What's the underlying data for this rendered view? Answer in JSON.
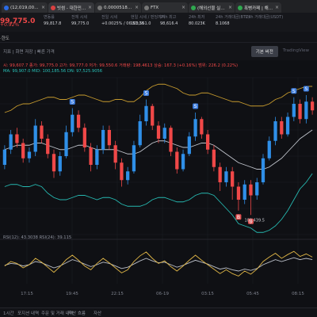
{
  "browser_tabs": [
    {
      "label": "(12,019,000 ↑) Coin…",
      "fav": "coin-logo-icon",
      "active": false
    },
    {
      "label": "빗썸 - 대한민국 대…",
      "fav": "bithumb-logo-icon",
      "active": true
    },
    {
      "label": "0.00005189 DAC…",
      "fav": "grey-logo-icon",
      "active": false
    },
    {
      "label": "FTX",
      "fav": "ftx-logo-icon",
      "active": false
    },
    {
      "label": "(해외선물 실전트…",
      "fav": "news-logo-icon",
      "active": false
    },
    {
      "label": "폭뻥카페 | 해선…",
      "fav": "cafe-logo-icon",
      "active": false
    }
  ],
  "ticker": {
    "price": "99,775.0",
    "change": "+0.92%",
    "stats": [
      {
        "key": "변동률",
        "value": "99,817.8"
      },
      {
        "key": "전체 시세",
        "value": "99,775.0"
      },
      {
        "key": "전일 시세",
        "value": "+0.0025% / 06:51:16"
      },
      {
        "key": "현일 시세 / 펀딩까지",
        "value": "103,551.0"
      },
      {
        "key": "24h 최고",
        "value": "98,616.4"
      },
      {
        "key": "24h 최저",
        "value": "80.023K"
      },
      {
        "key": "24h 거래대금(BTC)",
        "value": "8.1068"
      },
      {
        "key": "24h 거래대금(USDT)",
        "value": ""
      }
    ]
  },
  "toolbar": {
    "label": "·한도",
    "view_basic": "기본 버전",
    "view_tv": "TradingView",
    "indicator": "지표 | 화면 저장 | 빠른 가격"
  },
  "legend": {
    "ohlc": "시: 99,607.7  종가: 99,775.0  고가: 99,777.0  저가: 99,550.6  거래량: 198.4613  상승: 167.3 (+0.16%)  범위: 226.2 (0.22%)",
    "bb": "MA: 99,907.0  MID: 100,185.56  DN: 97,525.9056",
    "rsi": "RSI(12): 43.3038  RSI(24): 39.115"
  },
  "chart_data": {
    "type": "candlestick",
    "low_label": "103,439.5",
    "time_labels": [
      "17:15",
      "19:45",
      "22:15",
      "06-19",
      "03:15",
      "05:45",
      "08:15"
    ],
    "candles": [
      [
        99.2,
        99.9,
        99.0,
        100.1
      ],
      [
        99.9,
        100.6,
        99.7,
        100.8
      ],
      [
        100.6,
        100.2,
        100.0,
        100.9
      ],
      [
        100.2,
        99.5,
        99.3,
        100.4
      ],
      [
        99.5,
        99.8,
        99.3,
        100.0
      ],
      [
        99.8,
        101.0,
        99.6,
        101.3
      ],
      [
        101.0,
        100.4,
        100.2,
        101.2
      ],
      [
        100.4,
        99.7,
        99.5,
        100.6
      ],
      [
        99.7,
        98.9,
        98.6,
        99.9
      ],
      [
        98.9,
        99.6,
        98.7,
        99.8
      ],
      [
        99.6,
        100.7,
        99.5,
        101.0
      ],
      [
        100.7,
        101.5,
        100.5,
        101.8
      ],
      [
        101.5,
        100.9,
        100.7,
        101.7
      ],
      [
        100.9,
        100.0,
        99.8,
        101.1
      ],
      [
        100.0,
        99.2,
        98.9,
        100.2
      ],
      [
        99.2,
        99.9,
        99.0,
        100.1
      ],
      [
        99.9,
        100.8,
        99.7,
        101.0
      ],
      [
        100.8,
        100.1,
        99.9,
        101.0
      ],
      [
        100.1,
        99.3,
        99.0,
        100.3
      ],
      [
        99.3,
        98.5,
        98.2,
        99.5
      ],
      [
        98.5,
        98.9,
        98.3,
        99.1
      ],
      [
        98.9,
        100.1,
        98.8,
        100.3
      ],
      [
        100.1,
        101.2,
        100.0,
        101.5
      ],
      [
        101.2,
        101.9,
        101.0,
        102.2
      ],
      [
        101.9,
        101.0,
        100.8,
        102.0
      ],
      [
        101.0,
        100.4,
        100.2,
        101.2
      ],
      [
        100.4,
        100.9,
        100.2,
        101.1
      ],
      [
        100.9,
        99.8,
        99.6,
        101.0
      ],
      [
        99.8,
        99.0,
        98.8,
        100.0
      ],
      [
        99.0,
        99.7,
        98.9,
        99.9
      ],
      [
        99.7,
        100.5,
        99.6,
        100.7
      ],
      [
        100.5,
        101.3,
        100.3,
        101.6
      ],
      [
        101.3,
        100.6,
        100.4,
        101.4
      ],
      [
        100.6,
        99.9,
        99.7,
        100.8
      ],
      [
        99.9,
        99.1,
        98.9,
        100.1
      ],
      [
        99.1,
        98.4,
        98.0,
        99.3
      ],
      [
        98.4,
        98.9,
        98.2,
        99.1
      ],
      [
        98.9,
        98.2,
        97.6,
        99.1
      ],
      [
        98.2,
        97.6,
        97.1,
        98.4
      ],
      [
        97.6,
        98.3,
        97.4,
        98.5
      ],
      [
        98.3,
        97.8,
        96.9,
        98.5
      ],
      [
        97.8,
        98.4,
        97.6,
        98.6
      ],
      [
        98.4,
        99.5,
        98.3,
        99.7
      ],
      [
        99.5,
        100.3,
        99.4,
        100.5
      ],
      [
        100.3,
        101.2,
        100.1,
        101.4
      ],
      [
        101.2,
        100.6,
        100.4,
        101.4
      ],
      [
        100.6,
        101.4,
        100.5,
        101.6
      ],
      [
        101.4,
        102.0,
        101.2,
        102.3
      ],
      [
        102.0,
        101.3,
        101.1,
        102.2
      ],
      [
        101.3,
        102.1,
        101.1,
        102.4
      ],
      [
        102.1,
        101.7,
        101.5,
        102.3
      ]
    ],
    "bb_upper": [
      101.6,
      101.7,
      101.9,
      102.0,
      102.0,
      102.1,
      102.2,
      102.3,
      102.3,
      102.2,
      102.2,
      102.3,
      102.4,
      102.4,
      102.3,
      102.2,
      102.1,
      102.1,
      102.2,
      102.2,
      102.1,
      102.1,
      102.3,
      102.6,
      102.8,
      102.9,
      102.9,
      102.8,
      102.7,
      102.5,
      102.4,
      102.4,
      102.5,
      102.5,
      102.4,
      102.3,
      102.2,
      102.1,
      102.1,
      102.0,
      101.9,
      101.9,
      101.9,
      102.0,
      102.2,
      102.3,
      102.5,
      102.6,
      102.7,
      102.8,
      102.8
    ],
    "bb_mid": [
      99.9,
      100.0,
      100.1,
      100.1,
      100.1,
      100.2,
      100.2,
      100.1,
      100.0,
      99.9,
      99.9,
      100.0,
      100.1,
      100.1,
      100.0,
      99.9,
      99.9,
      99.9,
      99.9,
      99.8,
      99.7,
      99.7,
      99.8,
      100.0,
      100.2,
      100.3,
      100.3,
      100.2,
      100.1,
      100.0,
      100.0,
      100.1,
      100.2,
      100.2,
      100.1,
      99.9,
      99.7,
      99.5,
      99.3,
      99.2,
      99.1,
      99.0,
      99.0,
      99.1,
      99.3,
      99.5,
      99.8,
      100.1,
      100.4,
      100.6,
      100.8
    ],
    "bb_lower": [
      98.2,
      98.3,
      98.3,
      98.2,
      98.2,
      98.3,
      98.2,
      97.9,
      97.7,
      97.6,
      97.6,
      97.7,
      97.8,
      97.8,
      97.7,
      97.6,
      97.7,
      97.7,
      97.6,
      97.4,
      97.3,
      97.3,
      97.3,
      97.4,
      97.6,
      97.7,
      97.7,
      97.6,
      97.5,
      97.5,
      97.6,
      97.8,
      97.9,
      97.9,
      97.8,
      97.5,
      97.2,
      96.9,
      96.5,
      96.4,
      96.3,
      96.1,
      96.1,
      96.2,
      96.4,
      96.7,
      97.1,
      97.6,
      98.1,
      98.4,
      98.8
    ],
    "rsi12": [
      48,
      55,
      52,
      45,
      50,
      60,
      54,
      46,
      38,
      47,
      58,
      65,
      57,
      48,
      42,
      52,
      60,
      53,
      45,
      37,
      42,
      55,
      64,
      70,
      60,
      52,
      56,
      47,
      40,
      48,
      57,
      65,
      57,
      50,
      43,
      36,
      42,
      36,
      32,
      40,
      35,
      43,
      55,
      62,
      68,
      60,
      66,
      71,
      63,
      67,
      62
    ],
    "rsi24": [
      49,
      52,
      51,
      48,
      50,
      55,
      53,
      49,
      45,
      48,
      53,
      58,
      55,
      51,
      47,
      50,
      54,
      52,
      48,
      44,
      46,
      51,
      56,
      60,
      56,
      53,
      54,
      50,
      46,
      49,
      53,
      57,
      54,
      51,
      47,
      43,
      45,
      42,
      40,
      43,
      41,
      44,
      50,
      54,
      58,
      55,
      58,
      61,
      58,
      60,
      58
    ],
    "markers": [
      {
        "i": 11,
        "type": "S"
      },
      {
        "i": 23,
        "type": "S"
      },
      {
        "i": 31,
        "type": "S"
      },
      {
        "i": 38,
        "type": "B"
      },
      {
        "i": 40,
        "type": "B"
      },
      {
        "i": 47,
        "type": "S"
      },
      {
        "i": 49,
        "type": "S"
      }
    ],
    "colors": {
      "up": "#2f8fe8",
      "down": "#f04848",
      "bb_upper": "#c79b2e",
      "bb_mid": "#c0c4cc",
      "bb_lower": "#26b8b0",
      "rsi12": "#e0b646",
      "rsi24": "#b9bdc6"
    }
  },
  "bottom": {
    "items": [
      "1시간",
      "포지션 내역",
      "주문 및 거래 내역",
      "자산 흐름",
      "자산"
    ]
  }
}
